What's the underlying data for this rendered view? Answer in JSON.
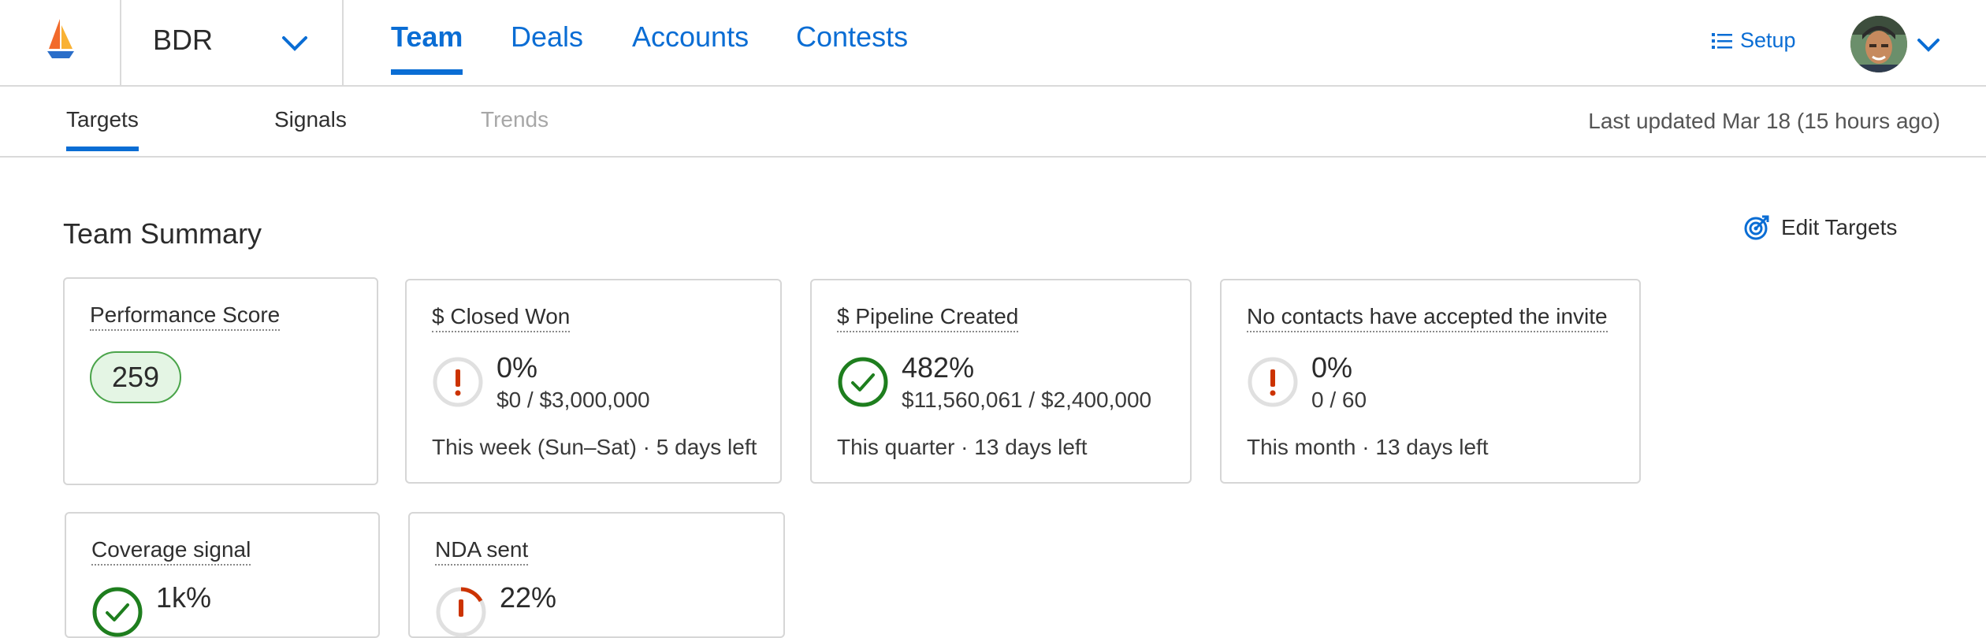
{
  "nav": {
    "team_name": "BDR",
    "links": [
      "Team",
      "Deals",
      "Accounts",
      "Contests"
    ],
    "setup_label": "Setup",
    "accent_color": "#0a6dd4"
  },
  "subnav": {
    "tabs": [
      "Targets",
      "Signals",
      "Trends"
    ],
    "last_updated": "Last updated Mar 18 (15 hours ago)"
  },
  "summary": {
    "title": "Team Summary",
    "edit_targets_label": "Edit Targets",
    "cards": [
      {
        "title": "Performance Score",
        "score": "259",
        "status": "score"
      },
      {
        "title": "$ Closed Won",
        "percent": "0%",
        "detail": "$0 / $3,000,000",
        "period": "This week (Sun–Sat) · 5 days left",
        "status": "warning"
      },
      {
        "title": "$ Pipeline Created",
        "percent": "482%",
        "detail": "$11,560,061 / $2,400,000",
        "period": "This quarter · 13 days left",
        "status": "success"
      },
      {
        "title": "No contacts have accepted the invite",
        "percent": "0%",
        "detail": "0 / 60",
        "period": "This month · 13 days left",
        "status": "warning"
      },
      {
        "title": "Coverage signal",
        "percent": "1k%",
        "status": "success"
      },
      {
        "title": "NDA sent",
        "percent": "22%",
        "status": "at-risk"
      }
    ]
  },
  "colors": {
    "success": "#1e7e1e",
    "warning": "#cc3300",
    "score_bg": "#e4f5e4",
    "score_border": "#4aa44a"
  }
}
